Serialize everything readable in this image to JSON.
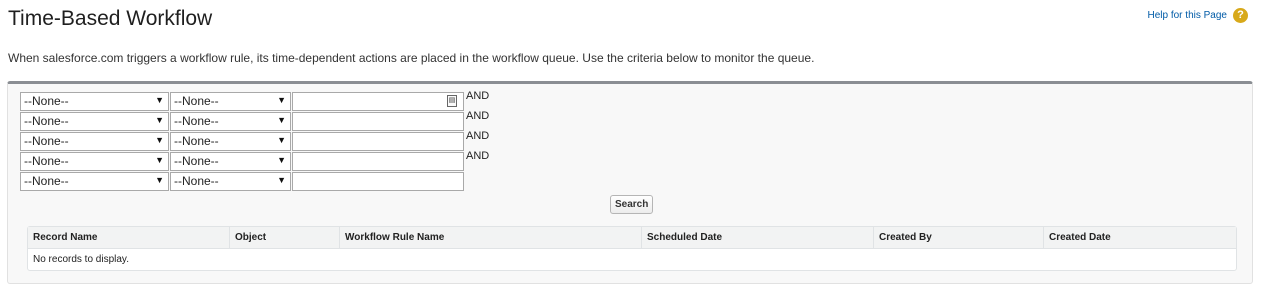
{
  "page": {
    "title": "Time-Based Workflow",
    "help_link": "Help for this Page",
    "help_icon": "help-icon",
    "description": "When salesforce.com triggers a workflow rule, its time-dependent actions are placed in the workflow queue. Use the criteria below to monitor the queue."
  },
  "criteria": {
    "rows": [
      {
        "field": "--None--",
        "operator": "--None--",
        "value": "",
        "connector": "AND"
      },
      {
        "field": "--None--",
        "operator": "--None--",
        "value": "",
        "connector": "AND"
      },
      {
        "field": "--None--",
        "operator": "--None--",
        "value": "",
        "connector": "AND"
      },
      {
        "field": "--None--",
        "operator": "--None--",
        "value": "",
        "connector": "AND"
      },
      {
        "field": "--None--",
        "operator": "--None--",
        "value": "",
        "connector": ""
      }
    ],
    "lookup_icon": "calendar-lookup-icon",
    "search_label": "Search"
  },
  "results": {
    "columns": [
      "Record Name",
      "Object",
      "Workflow Rule Name",
      "Scheduled Date",
      "Created By",
      "Created Date"
    ],
    "empty_message": "No records to display."
  },
  "colors": {
    "panel_border": "#8a8e93",
    "link": "#015ba7",
    "help_icon": "#d8a91a"
  }
}
